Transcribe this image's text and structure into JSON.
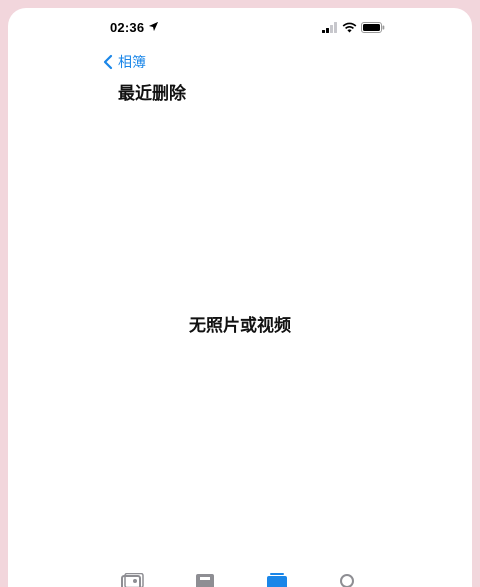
{
  "status_bar": {
    "time": "02:36"
  },
  "nav": {
    "back_label": "相簿"
  },
  "page": {
    "title": "最近删除",
    "empty_message": "无照片或视频"
  },
  "colors": {
    "accent": "#1a86e8",
    "background_outer": "#f2d6dc",
    "tab_inactive": "#8e8e93"
  },
  "tab_bar": {
    "icons": [
      "photos-icon",
      "for-you-icon",
      "albums-icon",
      "search-icon"
    ],
    "active_index": 2
  }
}
